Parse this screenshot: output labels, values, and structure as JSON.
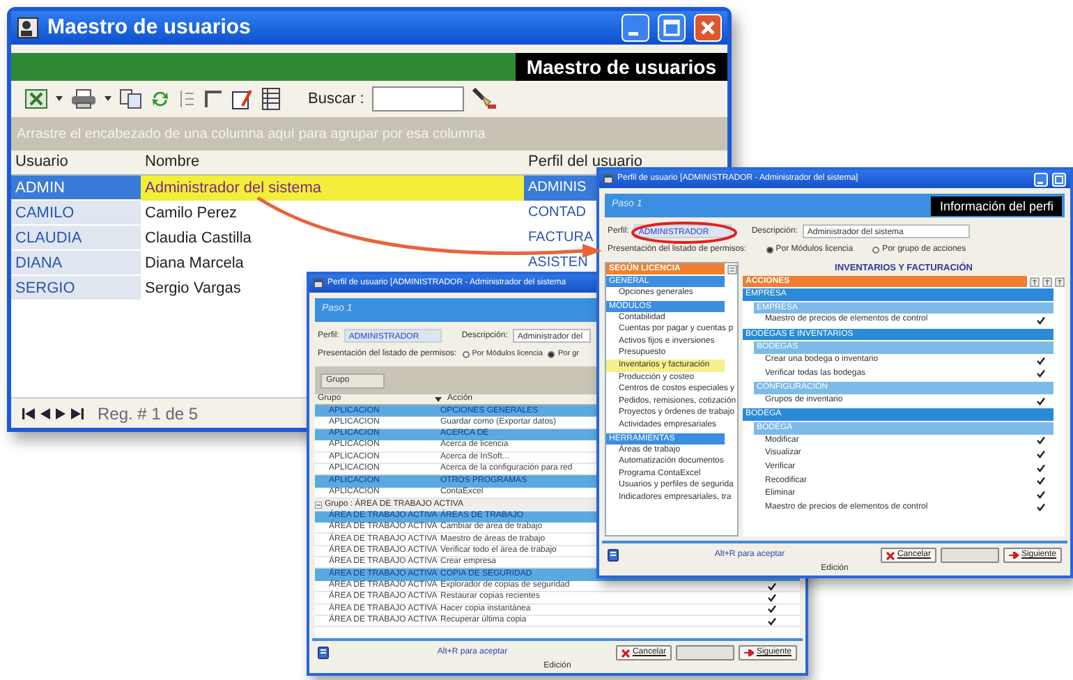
{
  "main_window": {
    "title": "Maestro de usuarios",
    "banner": "Maestro de usuarios",
    "search_label": "Buscar :",
    "group_hint": "Arrastre el encabezado de una columna aquí para agrupar por esa columna",
    "columns": [
      "Usuario",
      "Nombre",
      "Perfil del usuario"
    ],
    "rows": [
      {
        "usuario": "ADMIN",
        "nombre": "Administrador del sistema",
        "perfil": "ADMINIS",
        "selected": true
      },
      {
        "usuario": "CAMILO",
        "nombre": "Camilo Perez",
        "perfil": "CONTAD",
        "selected": false
      },
      {
        "usuario": "CLAUDIA",
        "nombre": "Claudia Castilla",
        "perfil": "FACTURA",
        "selected": false
      },
      {
        "usuario": "DIANA",
        "nombre": "Diana Marcela",
        "perfil": "ASISTEN",
        "selected": false
      },
      {
        "usuario": "SERGIO",
        "nombre": "Sergio Vargas",
        "selected": false
      }
    ],
    "record_label": "Reg. # 1 de 5"
  },
  "profile_window_back": {
    "title": "Perfil de usuario [ADMINISTRADOR - Administrador del sistema",
    "step": "Paso 1",
    "perfil_label": "Perfil:",
    "perfil": "ADMINISTRADOR",
    "descripcion_label": "Descripción:",
    "descripcion": "Administrador del",
    "presentation_label": "Presentación del listado de permisos:",
    "options": [
      {
        "label": "Por Módulos licencia",
        "selected": false
      },
      {
        "label": "Por gr",
        "selected": true
      }
    ],
    "group_chip": "Grupo",
    "columns": [
      "Grupo",
      "Acción"
    ],
    "rows": [
      {
        "kind": "header",
        "grupo": "APLICACION",
        "accion": "OPCIONES GENERALES"
      },
      {
        "kind": "item",
        "grupo": "APLICACION",
        "accion": "Guardar como (Exportar datos)"
      },
      {
        "kind": "header",
        "grupo": "APLICACION",
        "accion": "ACERCA DE"
      },
      {
        "kind": "item",
        "grupo": "APLICACION",
        "accion": "Acerca de licencia"
      },
      {
        "kind": "item",
        "grupo": "APLICACION",
        "accion": "Acerca de InSoft..."
      },
      {
        "kind": "item",
        "grupo": "APLICACION",
        "accion": "Acerca de la configuración para red"
      },
      {
        "kind": "header",
        "grupo": "APLICACION",
        "accion": "OTROS PROGRAMAS"
      },
      {
        "kind": "item",
        "grupo": "APLICACION",
        "accion": "ContaExcel"
      },
      {
        "kind": "group",
        "label": "Grupo : ÁREA DE TRABAJO ACTIVA"
      },
      {
        "kind": "header",
        "grupo": "ÁREA DE TRABAJO ACTIVA",
        "accion": "ÁREAS DE TRABAJO"
      },
      {
        "kind": "item",
        "grupo": "ÁREA DE TRABAJO ACTIVA",
        "accion": "Cambiar de área de trabajo"
      },
      {
        "kind": "item",
        "grupo": "ÁREA DE TRABAJO ACTIVA",
        "accion": "Maestro de áreas de trabajo"
      },
      {
        "kind": "item",
        "grupo": "ÁREA DE TRABAJO ACTIVA",
        "accion": "Verificar todo el área de trabajo"
      },
      {
        "kind": "item",
        "grupo": "ÁREA DE TRABAJO ACTIVA",
        "accion": "Crear empresa"
      },
      {
        "kind": "header",
        "grupo": "ÁREA DE TRABAJO ACTIVA",
        "accion": "COPIA DE SEGURIDAD"
      },
      {
        "kind": "item",
        "grupo": "ÁREA DE TRABAJO ACTIVA",
        "accion": "Explorador de copias de seguridad",
        "checked": true
      },
      {
        "kind": "item",
        "grupo": "ÁREA DE TRABAJO ACTIVA",
        "accion": "Restaurar copias recientes",
        "checked": true
      },
      {
        "kind": "item",
        "grupo": "ÁREA DE TRABAJO ACTIVA",
        "accion": "Hacer copia instantánea",
        "checked": true
      },
      {
        "kind": "item",
        "grupo": "ÁREA DE TRABAJO ACTIVA",
        "accion": "Recuperar última copia",
        "checked": true
      }
    ],
    "hint": "Alt+R para aceptar",
    "buttons": [
      {
        "kind": "cancel",
        "label": "Cancelar",
        "disabled": false
      },
      {
        "kind": "blank",
        "disabled": true
      },
      {
        "kind": "next",
        "label": "Siguiente",
        "disabled": false
      }
    ],
    "status": "Edición"
  },
  "profile_window_front": {
    "title": "Perfil de usuario [ADMINISTRADOR - Administrador del sistema]",
    "step": "Paso 1",
    "info_label": "Información del perfi",
    "perfil_label": "Perfil:",
    "perfil": "ADMINISTRADOR",
    "descripcion_label": "Descripción:",
    "descripcion": "Administrador del sistema",
    "presentation_label": "Presentación del listado de permisos:",
    "options": [
      {
        "label": "Por Módulos licencia",
        "selected": true
      },
      {
        "label": "Por grupo de acciones",
        "selected": false
      }
    ],
    "tree_title": "SEGÚN LICENCIA",
    "tree": [
      {
        "label": "GENERAL",
        "children": [
          {
            "label": "Opciones generales",
            "selected": false
          }
        ]
      },
      {
        "label": "MÓDULOS",
        "children": [
          {
            "label": "Contabilidad",
            "selected": false
          },
          {
            "label": "Cuentas por pagar y cuentas p",
            "selected": false
          },
          {
            "label": "Activos fijos e inversiones",
            "selected": false
          },
          {
            "label": "Presupuesto",
            "selected": false
          },
          {
            "label": "Inventarios y facturación",
            "selected": true
          },
          {
            "label": "Producción y costeo",
            "selected": false
          },
          {
            "label": "Centros de costos especiales y",
            "selected": false
          },
          {
            "label": "Pedidos, remisiones, cotización",
            "selected": false
          },
          {
            "label": "Proyectos y órdenes de trabajo",
            "selected": false
          },
          {
            "label": "Actividades empresariales",
            "selected": false
          }
        ]
      },
      {
        "label": "HERRAMIENTAS",
        "children": [
          {
            "label": "Áreas de trabajo",
            "selected": false
          },
          {
            "label": "Automatización documentos",
            "selected": false
          },
          {
            "label": "Programa ContaExcel",
            "selected": false
          },
          {
            "label": "Usuarios y perfiles de segurida",
            "selected": false
          },
          {
            "label": "Indicadores empresariales, tra",
            "selected": false
          }
        ]
      }
    ],
    "module_title": "INVENTARIOS Y FACTURACIÓN",
    "actions_title": "ACCIONES",
    "actions": [
      {
        "label": "EMPRESA",
        "children": [
          {
            "label": "EMPRESA",
            "children": [
              {
                "label": "Maestro de precios de elementos de control",
                "checked": true
              }
            ]
          }
        ]
      },
      {
        "label": "BODEGAS E INVENTARIOS",
        "children": [
          {
            "label": "BODEGAS",
            "children": [
              {
                "label": "Crear una bodega o inventario",
                "checked": true
              },
              {
                "label": "Verificar todas las bodegas",
                "checked": true
              }
            ]
          },
          {
            "label": "CONFIGURACIÓN",
            "children": [
              {
                "label": "Grupos de inventario",
                "checked": true
              }
            ]
          }
        ]
      },
      {
        "label": "BODEGA",
        "children": [
          {
            "label": "BODEGA",
            "children": [
              {
                "label": "Modificar",
                "checked": true
              },
              {
                "label": "Visualizar",
                "checked": true
              },
              {
                "label": "Verificar",
                "checked": true
              },
              {
                "label": "Recodificar",
                "checked": true
              },
              {
                "label": "Eliminar",
                "checked": true
              },
              {
                "label": "Maestro de precios de elementos de control",
                "checked": true
              }
            ]
          }
        ]
      }
    ],
    "hint": "Alt+R para aceptar",
    "buttons": [
      {
        "kind": "cancel",
        "label": "Cancelar",
        "disabled": false
      },
      {
        "kind": "blank",
        "disabled": true
      },
      {
        "kind": "next",
        "label": "Siguiente",
        "disabled": false
      }
    ],
    "status": "Edición"
  }
}
